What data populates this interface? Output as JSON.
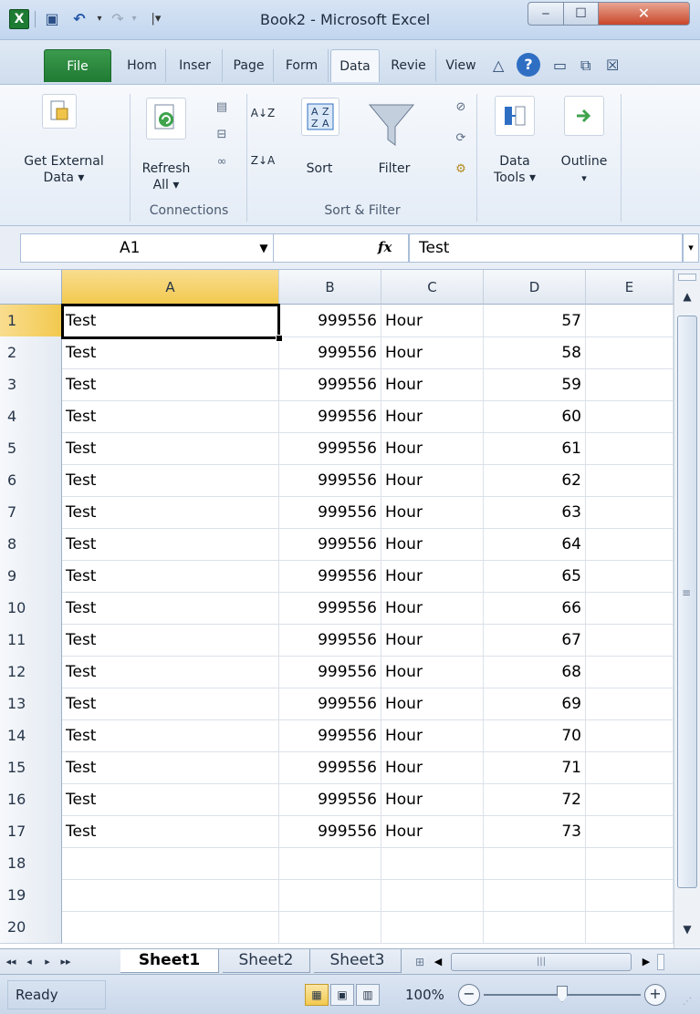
{
  "window": {
    "title": "Book2 - Microsoft Excel",
    "app_icon_letter": "X",
    "min_glyph": "‒",
    "max_glyph": "☐",
    "close_glyph": "✕"
  },
  "quick_access": {
    "save_glyph": "▣",
    "undo_glyph": "↶",
    "undo_menu_glyph": "▾",
    "redo_glyph": "↷",
    "redo_menu_glyph": "▾",
    "customize_glyph": "|▾"
  },
  "ribbon_tabs": {
    "file": "File",
    "home": "Hom",
    "insert": "Inser",
    "page": "Page",
    "formulas": "Form",
    "data": "Data",
    "review": "Revie",
    "view": "View",
    "minimize_glyph": "△",
    "help_glyph": "?",
    "restore_glyph": "▭",
    "window_glyph": "⧉",
    "close_glyph": "☒"
  },
  "ribbon": {
    "get_external_data": "Get External",
    "get_external_data_2": "Data ▾",
    "refresh": "Refresh",
    "refresh_2": "All ▾",
    "connections_group": "Connections",
    "sort_az_glyph": "A↓Z",
    "sort_za_glyph": "Z↓A",
    "sort": "Sort",
    "filter": "Filter",
    "sort_filter_group": "Sort & Filter",
    "data_tools": "Data",
    "data_tools_2": "Tools ▾",
    "outline": "Outline",
    "outline_2": "▾"
  },
  "formula_bar": {
    "name_box": "A1",
    "name_box_arrow": "▼",
    "fx": "fx",
    "formula": "Test",
    "expand_glyph": "▾"
  },
  "grid": {
    "columns": [
      "A",
      "B",
      "C",
      "D",
      "E"
    ],
    "rows": [
      {
        "n": "1",
        "a": "Test",
        "b": "999556",
        "c": "Hour",
        "d": "57"
      },
      {
        "n": "2",
        "a": "Test",
        "b": "999556",
        "c": "Hour",
        "d": "58"
      },
      {
        "n": "3",
        "a": "Test",
        "b": "999556",
        "c": "Hour",
        "d": "59"
      },
      {
        "n": "4",
        "a": "Test",
        "b": "999556",
        "c": "Hour",
        "d": "60"
      },
      {
        "n": "5",
        "a": "Test",
        "b": "999556",
        "c": "Hour",
        "d": "61"
      },
      {
        "n": "6",
        "a": "Test",
        "b": "999556",
        "c": "Hour",
        "d": "62"
      },
      {
        "n": "7",
        "a": "Test",
        "b": "999556",
        "c": "Hour",
        "d": "63"
      },
      {
        "n": "8",
        "a": "Test",
        "b": "999556",
        "c": "Hour",
        "d": "64"
      },
      {
        "n": "9",
        "a": "Test",
        "b": "999556",
        "c": "Hour",
        "d": "65"
      },
      {
        "n": "10",
        "a": "Test",
        "b": "999556",
        "c": "Hour",
        "d": "66"
      },
      {
        "n": "11",
        "a": "Test",
        "b": "999556",
        "c": "Hour",
        "d": "67"
      },
      {
        "n": "12",
        "a": "Test",
        "b": "999556",
        "c": "Hour",
        "d": "68"
      },
      {
        "n": "13",
        "a": "Test",
        "b": "999556",
        "c": "Hour",
        "d": "69"
      },
      {
        "n": "14",
        "a": "Test",
        "b": "999556",
        "c": "Hour",
        "d": "70"
      },
      {
        "n": "15",
        "a": "Test",
        "b": "999556",
        "c": "Hour",
        "d": "71"
      },
      {
        "n": "16",
        "a": "Test",
        "b": "999556",
        "c": "Hour",
        "d": "72"
      },
      {
        "n": "17",
        "a": "Test",
        "b": "999556",
        "c": "Hour",
        "d": "73"
      },
      {
        "n": "18",
        "a": "",
        "b": "",
        "c": "",
        "d": ""
      },
      {
        "n": "19",
        "a": "",
        "b": "",
        "c": "",
        "d": ""
      },
      {
        "n": "20",
        "a": "",
        "b": "",
        "c": "",
        "d": ""
      }
    ]
  },
  "scroll": {
    "up_glyph": "▲",
    "down_glyph": "▼",
    "grip_glyph": "≡",
    "left_glyph": "◀",
    "right_glyph": "▶",
    "hgrip_glyph": "|||"
  },
  "sheets": {
    "nav_first": "◂◂",
    "nav_prev": "◂",
    "nav_next": "▸",
    "nav_last": "▸▸",
    "tabs": [
      "Sheet1",
      "Sheet2",
      "Sheet3"
    ],
    "insert_glyph": "⊞"
  },
  "status": {
    "ready": "Ready",
    "normal_view_glyph": "▦",
    "page_layout_glyph": "▣",
    "page_break_glyph": "▥",
    "zoom": "100%",
    "zoom_out": "−",
    "zoom_in": "+",
    "zoom_level": 0.5,
    "grip_glyph": "⋰"
  }
}
